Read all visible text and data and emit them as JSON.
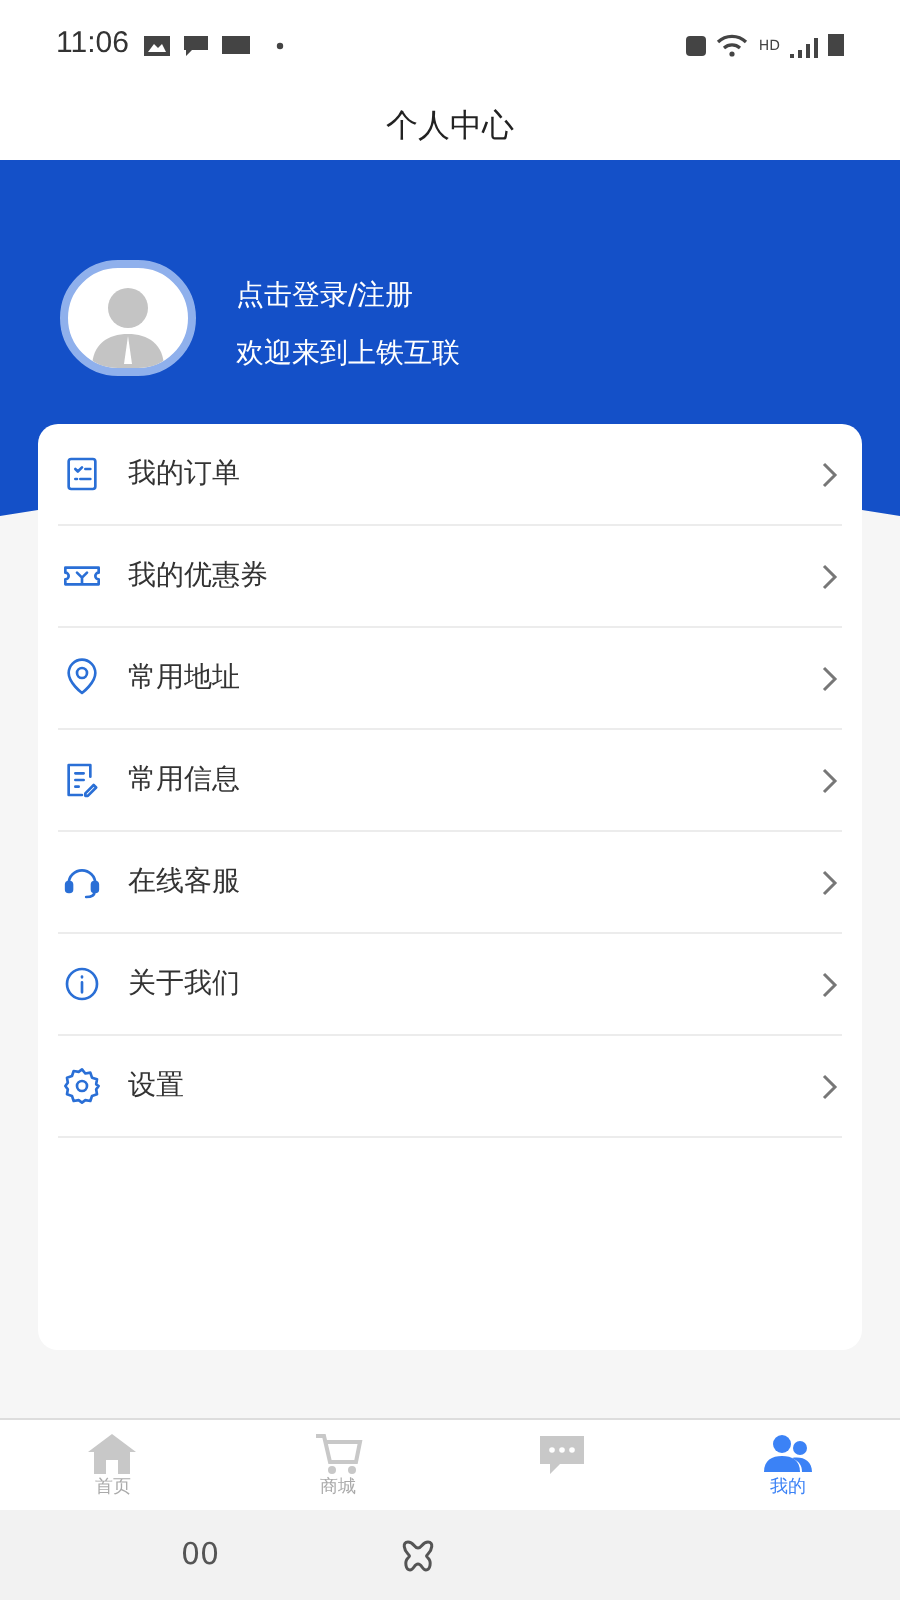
{
  "status_bar": {
    "time": "11:06",
    "network": "HD"
  },
  "header": {
    "title": "个人中心"
  },
  "profile": {
    "login": "点击登录/注册",
    "welcome": "欢迎来到上铁互联"
  },
  "menu": [
    {
      "kind": "orders",
      "label": "我的订单"
    },
    {
      "kind": "coupons",
      "label": "我的优惠券"
    },
    {
      "kind": "address",
      "label": "常用地址"
    },
    {
      "kind": "info",
      "label": "常用信息"
    },
    {
      "kind": "service",
      "label": "在线客服"
    },
    {
      "kind": "about",
      "label": "关于我们"
    },
    {
      "kind": "settings",
      "label": "设置"
    }
  ],
  "tabs": [
    {
      "kind": "home",
      "label": "首页",
      "selected": false
    },
    {
      "kind": "shop",
      "label": "商城",
      "selected": false
    },
    {
      "kind": "messages",
      "selected": false
    },
    {
      "kind": "mine",
      "label": "我的",
      "selected": true
    }
  ],
  "system_nav": {
    "recents": "00"
  }
}
